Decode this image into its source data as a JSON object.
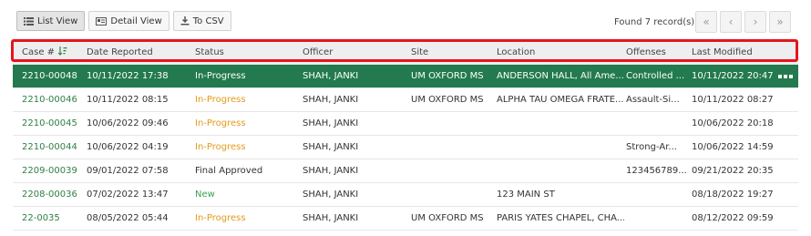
{
  "toolbar": {
    "list_view": "List View",
    "detail_view": "Detail View",
    "to_csv": "To CSV"
  },
  "found_text": "Found 7 record(s)",
  "pager": {
    "first": "«",
    "prev": "‹",
    "next": "›",
    "last": "»"
  },
  "columns": [
    "Case #",
    "Date Reported",
    "Status",
    "Officer",
    "Site",
    "Location",
    "Offenses",
    "Last Modified"
  ],
  "rows": [
    {
      "case": "2210-00048",
      "date": "10/11/2022 17:38",
      "status": "In-Progress",
      "officer": "SHAH, JANKI",
      "site": "UM OXFORD MS",
      "location": "ANDERSON HALL, All Ame...",
      "offenses": "Controlled ...",
      "modified": "10/11/2022 20:47"
    },
    {
      "case": "2210-00046",
      "date": "10/11/2022 08:15",
      "status": "In-Progress",
      "officer": "SHAH, JANKI",
      "site": "UM OXFORD MS",
      "location": "ALPHA TAU OMEGA FRATE...",
      "offenses": "Assault-Si...",
      "modified": "10/11/2022 08:27"
    },
    {
      "case": "2210-00045",
      "date": "10/06/2022 09:46",
      "status": "In-Progress",
      "officer": "SHAH, JANKI",
      "site": "",
      "location": "",
      "offenses": "",
      "modified": "10/06/2022 20:18"
    },
    {
      "case": "2210-00044",
      "date": "10/06/2022 04:19",
      "status": "In-Progress",
      "officer": "SHAH, JANKI",
      "site": "",
      "location": "",
      "offenses": "Strong-Ar...",
      "modified": "10/06/2022 14:59"
    },
    {
      "case": "2209-00039",
      "date": "09/01/2022 07:58",
      "status": "Final Approved",
      "officer": "SHAH, JANKI",
      "site": "",
      "location": "",
      "offenses": "123456789...",
      "modified": "09/21/2022 20:35"
    },
    {
      "case": "2208-00036",
      "date": "07/02/2022 13:47",
      "status": "New",
      "officer": "SHAH, JANKI",
      "site": "",
      "location": "123 MAIN ST",
      "offenses": "",
      "modified": "08/18/2022 19:27"
    },
    {
      "case": "22-0035",
      "date": "08/05/2022 05:44",
      "status": "In-Progress",
      "officer": "SHAH, JANKI",
      "site": "UM OXFORD MS",
      "location": "PARIS YATES CHAPEL, CHA...",
      "offenses": "",
      "modified": "08/12/2022 09:59"
    }
  ],
  "colors": {
    "selected_row": "#237a4f",
    "in_progress": "#e39b18",
    "new": "#3aa152",
    "highlight_border": "#e8141c"
  }
}
